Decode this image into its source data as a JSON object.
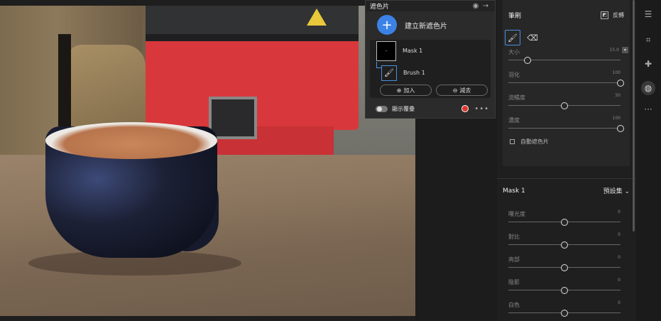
{
  "mask_panel": {
    "title": "遮色片",
    "create_label": "建立新遮色片",
    "items": [
      {
        "name": "Mask 1"
      },
      {
        "name": "Brush 1"
      }
    ],
    "add_label": "加入",
    "subtract_label": "減去",
    "overlay_label": "顯示覆疊",
    "overlay_color": "#e0352a"
  },
  "brush": {
    "title": "筆刷",
    "invert_label": "反轉",
    "size": {
      "label": "大小",
      "value": "15.0",
      "level": 0.17
    },
    "feather": {
      "label": "羽化",
      "value": "100",
      "level": 1.0
    },
    "flow": {
      "label": "流暢度",
      "value": "50",
      "level": 0.5
    },
    "density": {
      "label": "濃度",
      "value": "100",
      "level": 1.0
    },
    "auto_mask_label": "自動遮色片"
  },
  "mask1": {
    "title": "Mask 1",
    "preset_label": "預設集",
    "adjustments": [
      {
        "label": "曝光度",
        "value": "0",
        "level": 0.5
      },
      {
        "label": "對比",
        "value": "0",
        "level": 0.5
      },
      {
        "label": "亮部",
        "value": "0",
        "level": 0.5
      },
      {
        "label": "陰影",
        "value": "0",
        "level": 0.5
      },
      {
        "label": "白色",
        "value": "0",
        "level": 0.5
      }
    ]
  },
  "accent_color": "#3b82e6"
}
